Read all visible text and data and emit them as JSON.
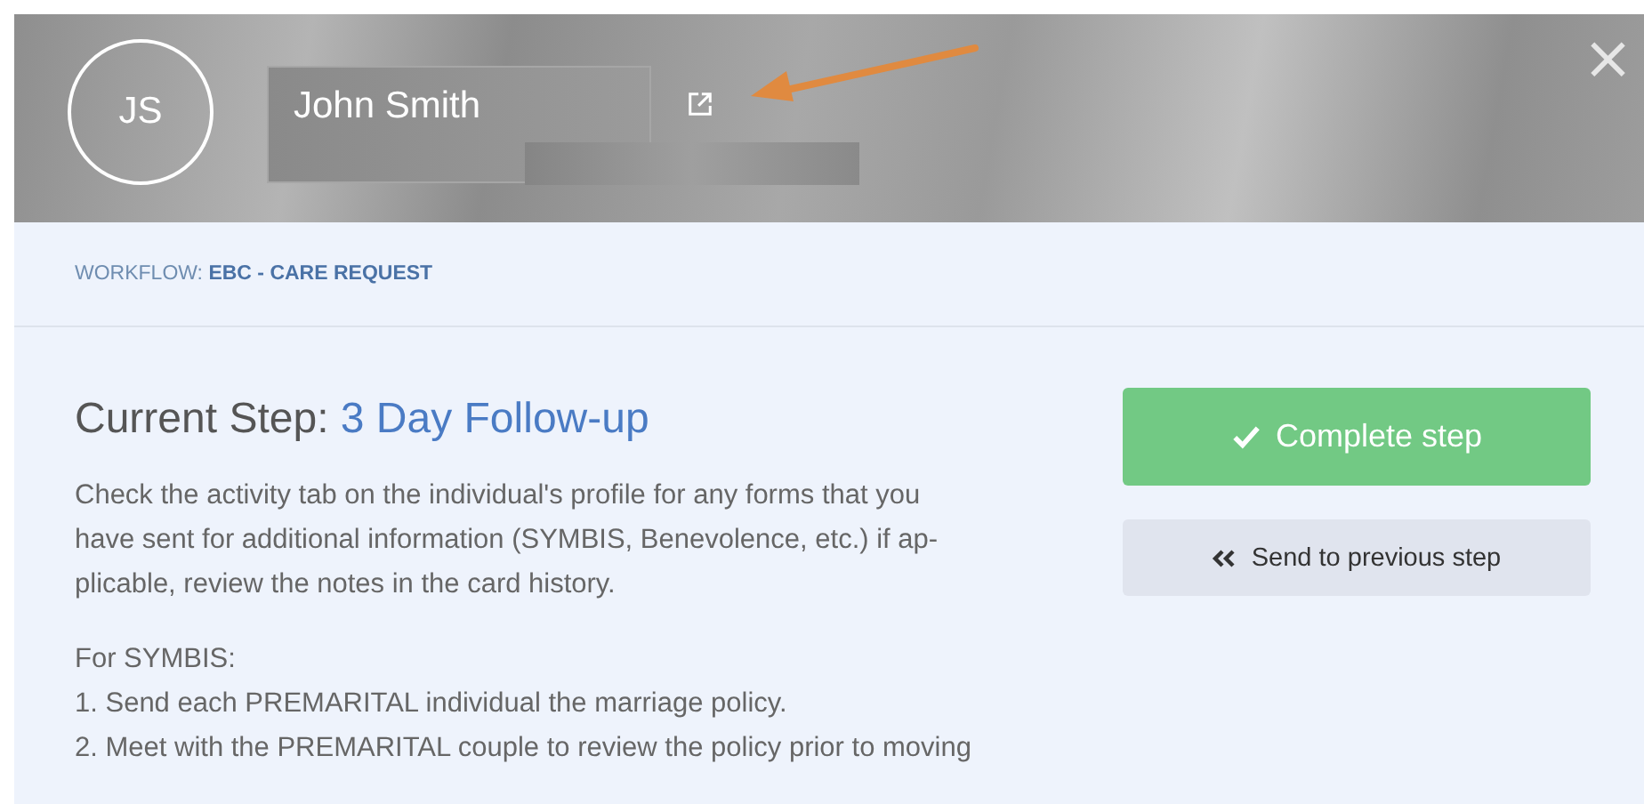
{
  "header": {
    "initials": "JS",
    "name": "John Smith",
    "close": "×"
  },
  "workflow": {
    "label": "WORKFLOW:",
    "name": "EBC - CARE REQUEST"
  },
  "step": {
    "label": "Current Step:",
    "name": "3 Day Follow-up"
  },
  "description_lines": [
    "Check the activity tab on the individual's profile for any forms that you",
    "have sent for additional information (SYMBIS, Benevolence, etc.) if ap-",
    "plicable, review the notes in the card history."
  ],
  "instructions": [
    "For SYMBIS:",
    "1. Send each PREMARITAL individual the marriage policy.",
    "2. Meet with the PREMARITAL couple to review the policy prior to moving"
  ],
  "buttons": [
    {
      "kind": "primary",
      "label": "Complete step"
    },
    {
      "kind": "secondary",
      "label": "Send to previous step"
    }
  ]
}
